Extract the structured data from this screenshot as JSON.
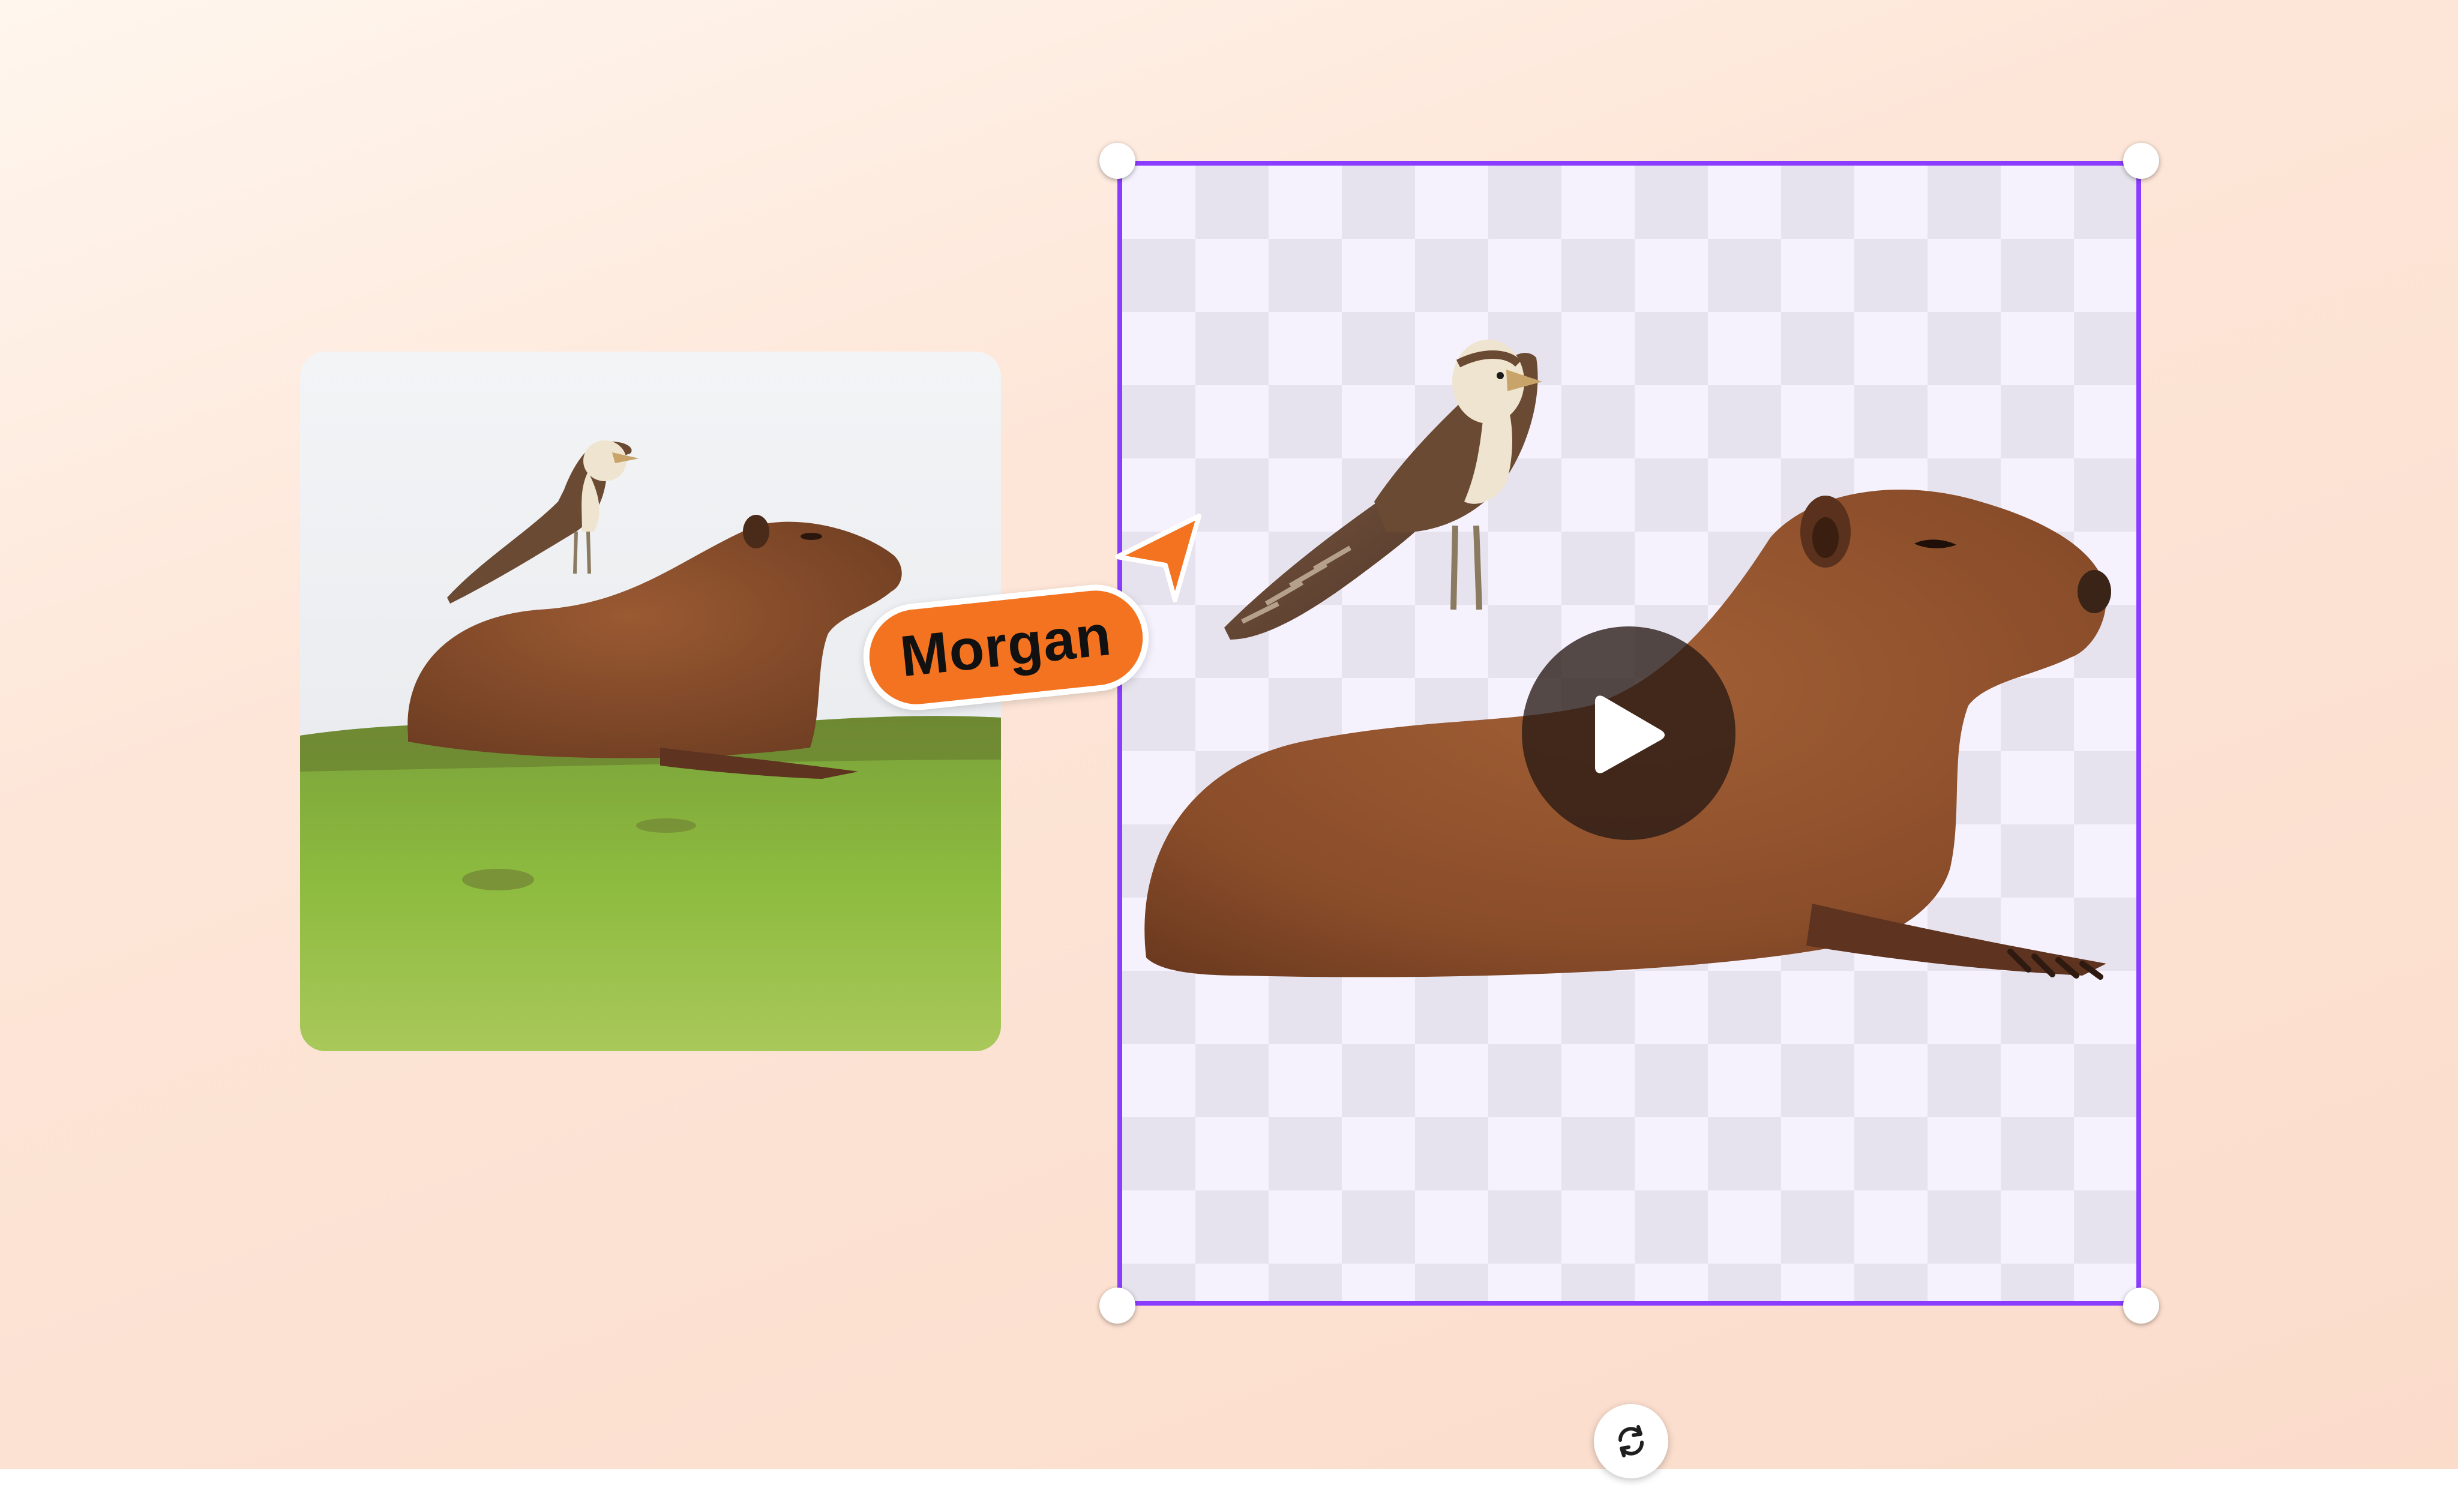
{
  "collaborator": {
    "name": "Morgan",
    "color": "#f47320"
  },
  "selection": {
    "border_color": "#8b3dff"
  },
  "icons": {
    "play": "play-icon",
    "rotate": "rotate-icon",
    "cursor": "cursor-arrow-icon"
  },
  "colors": {
    "background_start": "#fff6ee",
    "background_end": "#fbdccb",
    "checker_light": "#f6f2fd",
    "checker_dark": "#e7e3ee"
  }
}
